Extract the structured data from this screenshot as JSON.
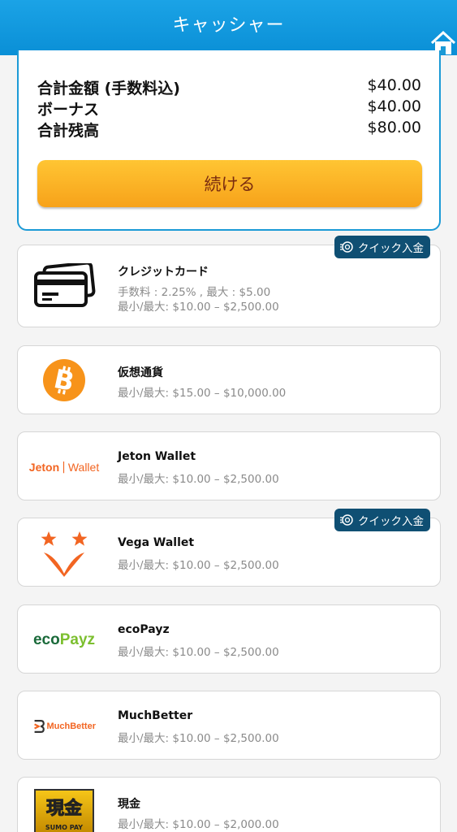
{
  "header": {
    "title": "キャッシャー"
  },
  "summary": {
    "rows": [
      {
        "label": "合計金額 (手数料込)",
        "value": "$40.00"
      },
      {
        "label": "ボーナス",
        "value": "$40.00"
      },
      {
        "label": "合計残高",
        "value": "$80.00"
      }
    ],
    "continue_label": "続ける"
  },
  "quick_badge_label": "クイック入金",
  "methods": [
    {
      "name": "クレジットカード",
      "fee": "手数料 : 2.25% , 最大 : $5.00",
      "limits": "最小/最大: $10.00 – $2,500.00",
      "quick": true
    },
    {
      "name": "仮想通貨",
      "limits": "最小/最大: $15.00 – $10,000.00",
      "quick": false
    },
    {
      "name": "Jeton Wallet",
      "limits": "最小/最大: $10.00 – $2,500.00",
      "quick": false,
      "logo_text": [
        "Jeton",
        "Wallet"
      ]
    },
    {
      "name": "Vega Wallet",
      "limits": "最小/最大: $10.00 – $2,500.00",
      "quick": true
    },
    {
      "name": "ecoPayz",
      "limits": "最小/最大: $10.00 – $2,500.00",
      "quick": false,
      "logo_text": [
        "eco",
        "Payz"
      ]
    },
    {
      "name": "MuchBetter",
      "limits": "最小/最大: $10.00 – $2,500.00",
      "quick": false,
      "logo_text": [
        "MuchBetter"
      ]
    },
    {
      "name": "現金",
      "limits": "最小/最大: $10.00 – $2,000.00",
      "quick": false,
      "logo_text": [
        "現金",
        "SUMO PAY"
      ]
    }
  ],
  "colors": {
    "header": "#0a8fd6",
    "accent": "#f7a21a",
    "badge": "#0f4f73"
  }
}
